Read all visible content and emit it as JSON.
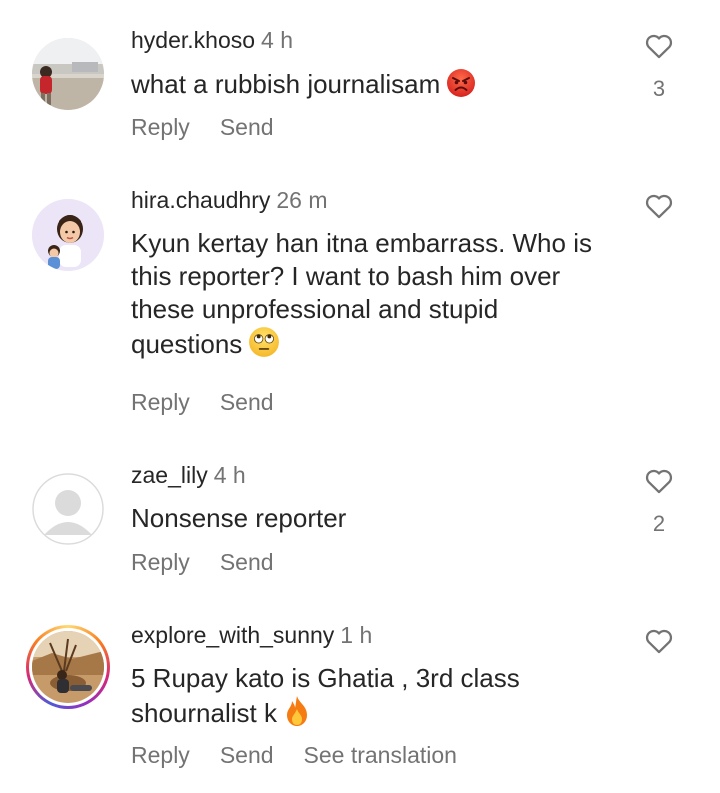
{
  "actions": {
    "reply": "Reply",
    "send": "Send",
    "see_translation": "See translation"
  },
  "comments": [
    {
      "username": "hyder.khoso",
      "time": "4 h",
      "text": "what a rubbish journalisam",
      "emoji": "angry-face-icon",
      "likes": "3"
    },
    {
      "username": "hira.chaudhry",
      "time": "26 m",
      "text": "Kyun kertay han itna embarrass. Who is this reporter? I want to bash him over these unprofessional and stupid questions",
      "emoji": "eye-roll-face-icon",
      "likes": ""
    },
    {
      "username": "zae_lily",
      "time": "4 h",
      "text": "Nonsense reporter",
      "emoji": "",
      "likes": "2"
    },
    {
      "username": "explore_with_sunny",
      "time": "1 h",
      "text": "5 Rupay kato is Ghatia , 3rd class shournalist k",
      "emoji": "fire-icon",
      "likes": ""
    }
  ],
  "colors": {
    "text": "#262626",
    "secondary": "#737373",
    "story_ring": "#d62976"
  }
}
